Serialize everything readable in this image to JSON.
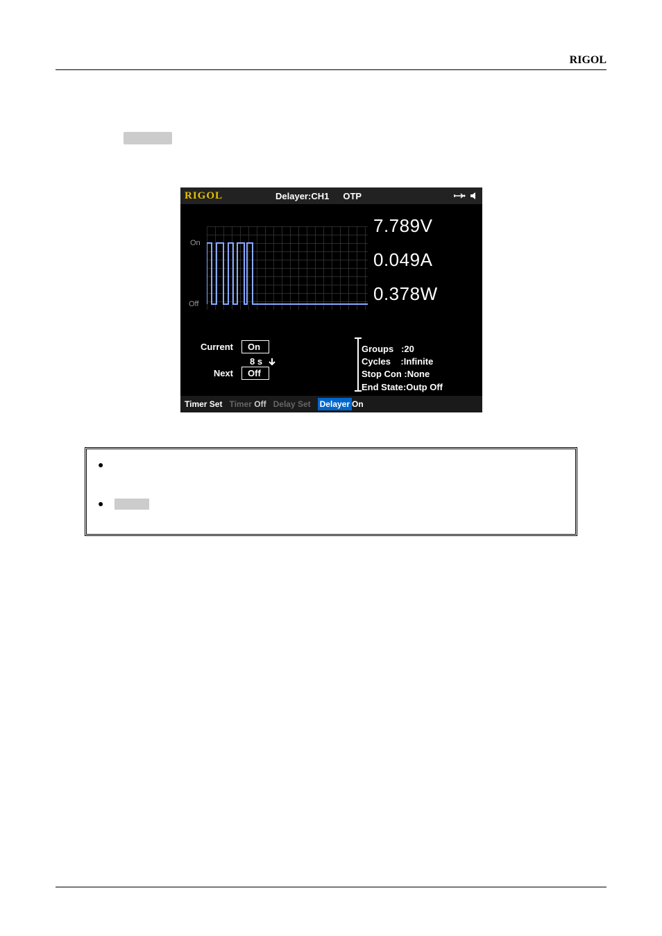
{
  "header": {
    "brand": "RIGOL"
  },
  "screenshot": {
    "logo": "RIGOL",
    "title": "Delayer:CH1",
    "otp": "OTP",
    "y_on": "On",
    "y_off": "Off",
    "readings": {
      "voltage": "7.789V",
      "current": "0.049A",
      "power": "0.378W"
    },
    "left": {
      "current_label": "Current",
      "current_value": "On",
      "time": "8 s",
      "next_label": "Next",
      "next_value": "Off"
    },
    "right": {
      "groups_label": "Groups",
      "groups_value": ":20",
      "cycles_label": "Cycles",
      "cycles_value": ":Infinite",
      "stop": "Stop Con :None",
      "end": "End State:Outp Off"
    },
    "bottom": {
      "label": "Timer Set",
      "timer": "Timer",
      "timer_state": "Off",
      "delay_set": "Delay Set",
      "delayer": "Delayer",
      "delayer_state": "On"
    }
  }
}
